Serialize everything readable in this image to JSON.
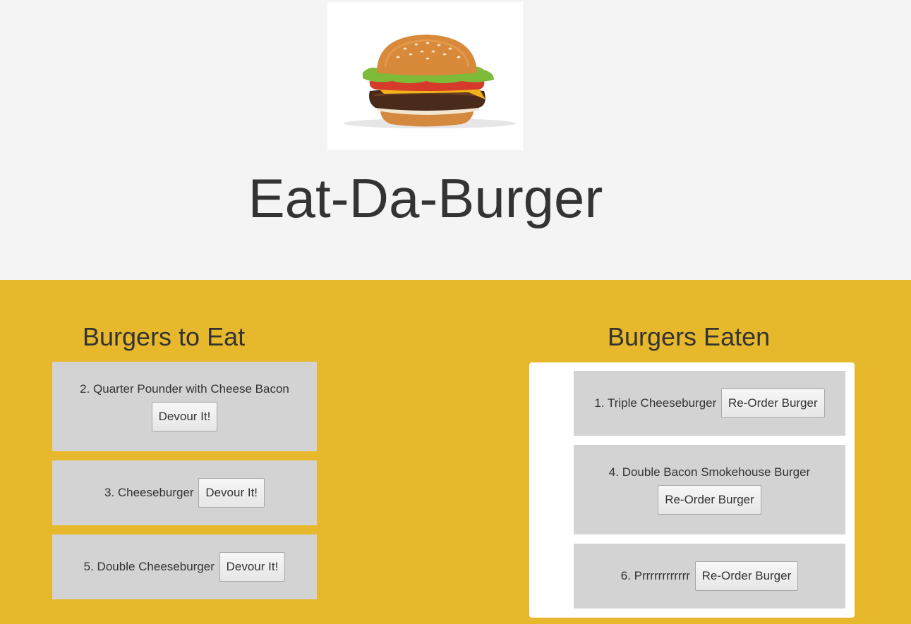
{
  "app": {
    "title": "Eat-Da-Burger",
    "logo_icon": "burger-image"
  },
  "colors": {
    "header_bg": "#f4f4f4",
    "main_bg": "#e7b82c",
    "card_bg": "#d3d3d3",
    "panel_bg": "#ffffff"
  },
  "to_eat": {
    "heading": "Burgers to Eat",
    "items": [
      {
        "label": "2. Quarter Pounder with Cheese Bacon",
        "button": "Devour It!"
      },
      {
        "label": "3. Cheeseburger",
        "button": "Devour It!"
      },
      {
        "label": "5. Double Cheeseburger",
        "button": "Devour It!"
      }
    ]
  },
  "eaten": {
    "heading": "Burgers Eaten",
    "items": [
      {
        "label": "1. Triple Cheeseburger",
        "button": "Re-Order Burger"
      },
      {
        "label": "4. Double Bacon Smokehouse Burger",
        "button": "Re-Order Burger"
      },
      {
        "label": "6. Prrrrrrrrrrrr",
        "button": "Re-Order Burger"
      }
    ]
  }
}
